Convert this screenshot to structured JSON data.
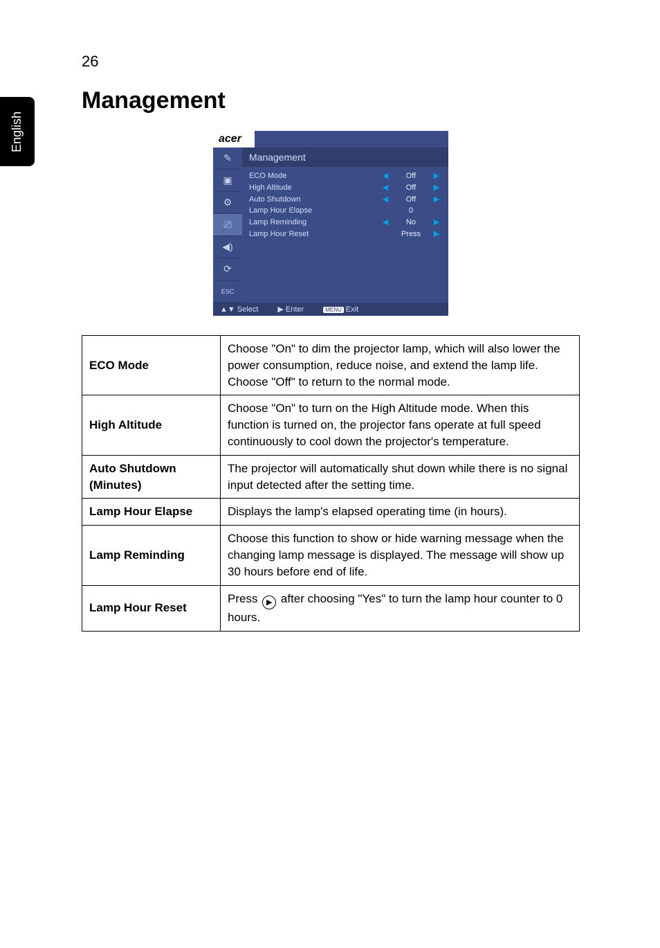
{
  "side_tab": "English",
  "page_number": "26",
  "title": "Management",
  "osd": {
    "logo": "acer",
    "header": "Management",
    "rows": [
      {
        "label": "ECO Mode",
        "left": "◀",
        "value": "Off",
        "right": "▶"
      },
      {
        "label": "High Altitude",
        "left": "◀",
        "value": "Off",
        "right": "▶"
      },
      {
        "label": "Auto Shutdown",
        "left": "◀",
        "value": "Off",
        "right": "▶"
      },
      {
        "label": "Lamp Hour Elapse",
        "left": "",
        "value": "0",
        "right": ""
      },
      {
        "label": "Lamp Reminding",
        "left": "◀",
        "value": "No",
        "right": "▶"
      },
      {
        "label": "Lamp Hour Reset",
        "left": "",
        "value": "Press",
        "right": "▶"
      }
    ],
    "footer": {
      "select": "▲▼ Select",
      "enter": "▶ Enter",
      "exit_badge": "MENU",
      "exit": "Exit"
    },
    "tab_icons": [
      "✎",
      "▣",
      "⚙",
      "⎚",
      "◀)",
      "⟳",
      "ESC"
    ]
  },
  "table": [
    {
      "name": "ECO Mode",
      "desc": "Choose \"On\" to dim the projector lamp, which will also lower the power consumption, reduce noise, and extend the lamp life. Choose \"Off\" to return to the normal mode."
    },
    {
      "name": "High Altitude",
      "desc": "Choose \"On\" to turn on the High Altitude mode. When this function is turned on, the projector fans operate at full speed continuously to cool down the projector's temperature."
    },
    {
      "name": "Auto Shutdown (Minutes)",
      "desc": "The projector will automatically shut down while there is no signal input detected after the setting time."
    },
    {
      "name": "Lamp Hour Elapse",
      "desc": "Displays the lamp's elapsed operating time (in hours)."
    },
    {
      "name": "Lamp Reminding",
      "desc": "Choose this function to show or hide warning message when the changing lamp message is displayed. The message will show up 30 hours before end of life."
    },
    {
      "name": "Lamp Hour Reset",
      "desc_pre": "Press ",
      "desc_post": " after choosing \"Yes\" to turn the lamp hour counter to 0 hours."
    }
  ]
}
